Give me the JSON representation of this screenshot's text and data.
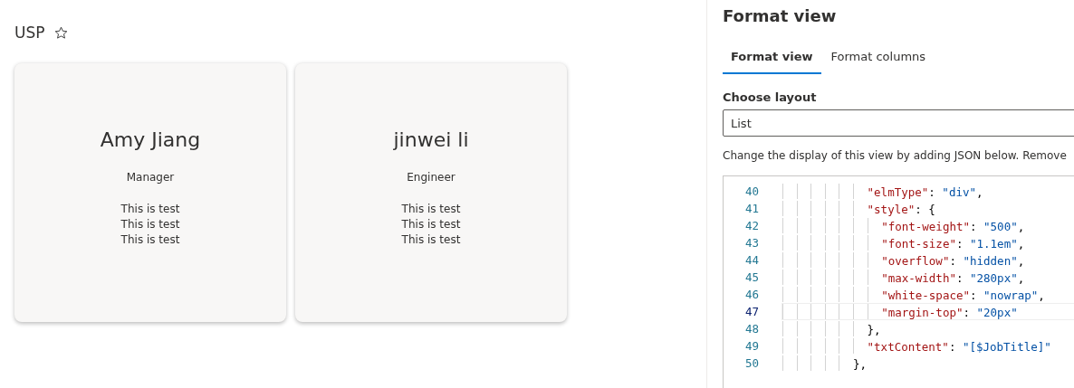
{
  "list": {
    "title": "USP",
    "favorite": false
  },
  "cards": [
    {
      "name": "Amy Jiang",
      "job_title": "Manager",
      "notes": [
        "This is test",
        "This is test",
        "This is test"
      ]
    },
    {
      "name": "jinwei li",
      "job_title": "Engineer",
      "notes": [
        "This is test",
        "This is test",
        "This is test"
      ]
    }
  ],
  "panel": {
    "title": "Format view",
    "tabs": [
      {
        "label": "Format view",
        "selected": true
      },
      {
        "label": "Format columns",
        "selected": false
      }
    ],
    "layout_label": "Choose layout",
    "layout_value": "List",
    "description": "Change the display of this view by adding JSON below. Remove",
    "code": [
      {
        "children": [
          {
            "number": "40",
            "current": false,
            "parts": [
              {
                "kind": "key",
                "text": "\"elmType\""
              },
              {
                "kind": "punct",
                "text": ": "
              },
              {
                "kind": "string",
                "text": "\"div\""
              },
              {
                "kind": "punct",
                "text": ","
              }
            ]
          },
          {
            "number": "41",
            "current": false,
            "parts": [
              {
                "kind": "key",
                "text": "\"style\""
              },
              {
                "kind": "punct",
                "text": ": {"
              }
            ],
            "children": [
              {
                "number": "42",
                "current": false,
                "parts": [
                  {
                    "kind": "key",
                    "text": "\"font-weight\""
                  },
                  {
                    "kind": "punct",
                    "text": ": "
                  },
                  {
                    "kind": "string",
                    "text": "\"500\""
                  },
                  {
                    "kind": "punct",
                    "text": ","
                  }
                ]
              },
              {
                "number": "43",
                "current": false,
                "parts": [
                  {
                    "kind": "key",
                    "text": "\"font-size\""
                  },
                  {
                    "kind": "punct",
                    "text": ": "
                  },
                  {
                    "kind": "string",
                    "text": "\"1.1em\""
                  },
                  {
                    "kind": "punct",
                    "text": ","
                  }
                ]
              },
              {
                "number": "44",
                "current": false,
                "parts": [
                  {
                    "kind": "key",
                    "text": "\"overflow\""
                  },
                  {
                    "kind": "punct",
                    "text": ": "
                  },
                  {
                    "kind": "string",
                    "text": "\"hidden\""
                  },
                  {
                    "kind": "punct",
                    "text": ","
                  }
                ]
              },
              {
                "number": "45",
                "current": false,
                "parts": [
                  {
                    "kind": "key",
                    "text": "\"max-width\""
                  },
                  {
                    "kind": "punct",
                    "text": ": "
                  },
                  {
                    "kind": "string",
                    "text": "\"280px\""
                  },
                  {
                    "kind": "punct",
                    "text": ","
                  }
                ]
              },
              {
                "number": "46",
                "current": false,
                "parts": [
                  {
                    "kind": "key",
                    "text": "\"white-space\""
                  },
                  {
                    "kind": "punct",
                    "text": ": "
                  },
                  {
                    "kind": "string",
                    "text": "\"nowrap\""
                  },
                  {
                    "kind": "punct",
                    "text": ","
                  }
                ]
              },
              {
                "number": "47",
                "current": true,
                "parts": [
                  {
                    "kind": "key",
                    "text": "\"margin-top\""
                  },
                  {
                    "kind": "punct",
                    "text": ": "
                  },
                  {
                    "kind": "string",
                    "text": "\"20px\""
                  }
                ]
              }
            ]
          },
          {
            "number": "48",
            "current": false,
            "parts": [
              {
                "kind": "punct",
                "text": "},"
              }
            ]
          },
          {
            "number": "49",
            "current": false,
            "parts": [
              {
                "kind": "key",
                "text": "\"txtContent\""
              },
              {
                "kind": "punct",
                "text": ": "
              },
              {
                "kind": "string",
                "text": "\"[$JobTitle]\""
              }
            ]
          }
        ]
      },
      {
        "number": "50",
        "current": false,
        "parts": [
          {
            "kind": "punct",
            "text": "},"
          }
        ]
      }
    ]
  }
}
